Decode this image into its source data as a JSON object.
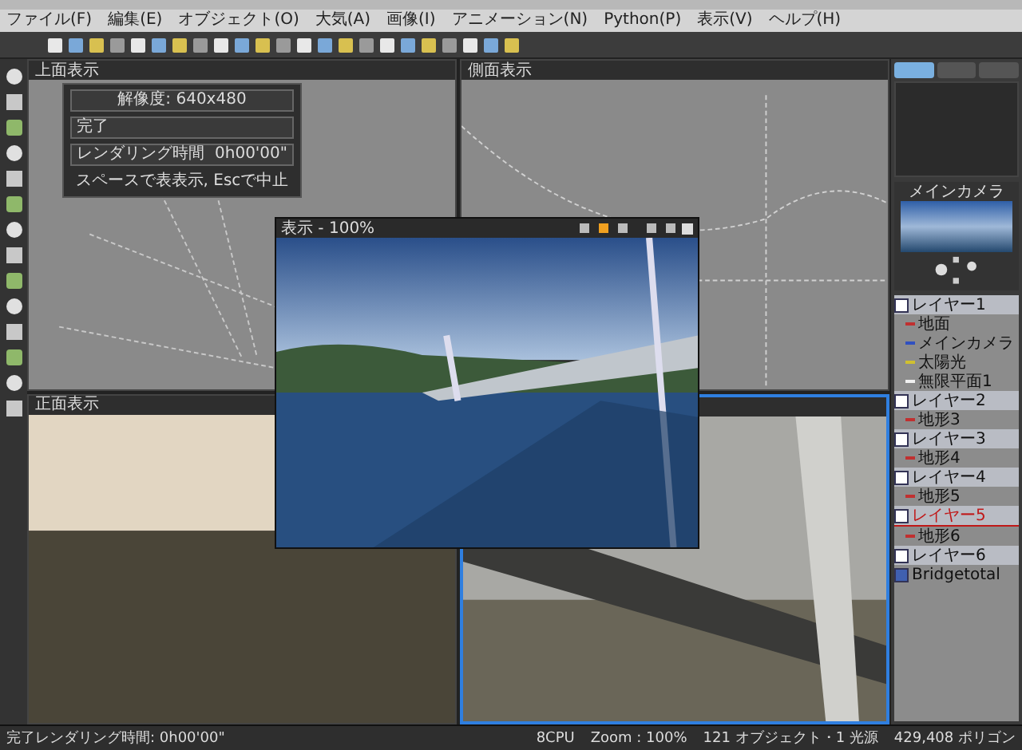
{
  "menu": [
    "ファイル(F)",
    "編集(E)",
    "オブジェクト(O)",
    "大気(A)",
    "画像(I)",
    "アニメーション(N)",
    "Python(P)",
    "表示(V)",
    "ヘルプ(H)"
  ],
  "viewports": [
    {
      "title": "上面表示",
      "kind": "top",
      "selected": false
    },
    {
      "title": "側面表示",
      "kind": "side",
      "selected": false
    },
    {
      "title": "正面表示",
      "kind": "front",
      "selected": false
    },
    {
      "kind": "perspective",
      "selected": true
    }
  ],
  "render_overlay": {
    "resolution": "解像度: 640x480",
    "status": "完了",
    "time_label": "レンダリング時間",
    "time": "0h00'00\"",
    "hint": "スペースで表表示, Escで中止"
  },
  "render_window": {
    "title": "表示 - 100%"
  },
  "camera_panel": {
    "title": "メインカメラ"
  },
  "browser": {
    "items": [
      {
        "label": "レイヤー1",
        "kind": "layer",
        "selected": false,
        "children": [
          {
            "label": "地面",
            "kind": "object",
            "selected": false
          },
          {
            "label": "メインカメラ",
            "kind": "camera",
            "selected": false
          },
          {
            "label": "太陽光",
            "kind": "light",
            "selected": false
          },
          {
            "label": "無限平面1",
            "kind": "plane",
            "selected": false
          }
        ]
      },
      {
        "label": "レイヤー2",
        "kind": "layer",
        "selected": false,
        "children": [
          {
            "label": "地形3",
            "kind": "object",
            "selected": false
          }
        ]
      },
      {
        "label": "レイヤー3",
        "kind": "layer",
        "selected": false,
        "children": [
          {
            "label": "地形4",
            "kind": "object",
            "selected": false
          }
        ]
      },
      {
        "label": "レイヤー4",
        "kind": "layer",
        "selected": false,
        "children": [
          {
            "label": "地形5",
            "kind": "object",
            "selected": false
          }
        ]
      },
      {
        "label": "レイヤー5",
        "kind": "layer",
        "selected": true,
        "children": [
          {
            "label": "地形6",
            "kind": "object",
            "selected": false
          }
        ]
      },
      {
        "label": "レイヤー6",
        "kind": "layer",
        "selected": false
      },
      {
        "label": "Bridgetotal",
        "kind": "group",
        "selected": false
      }
    ]
  },
  "status_bar": {
    "message": "完了レンダリング時間: 0h00'00\"",
    "cpu": "8CPU",
    "zoom": "Zoom : 100%",
    "objects": "121 オブジェクト・1 光源",
    "polygons": "429,408 ポリゴン"
  }
}
